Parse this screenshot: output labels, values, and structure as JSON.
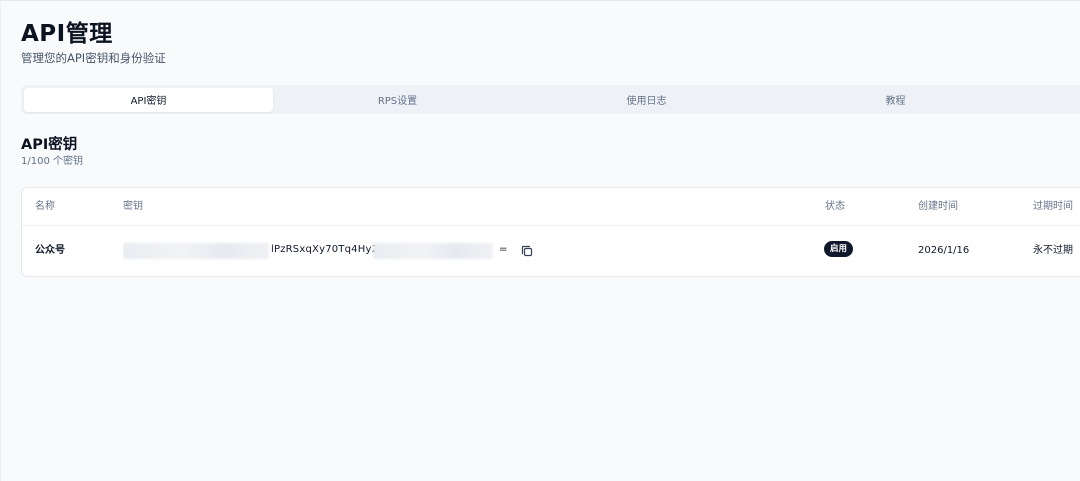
{
  "header": {
    "title": "API管理",
    "subtitle": "管理您的API密钥和身份验证"
  },
  "tabs": [
    {
      "label": "API密钥",
      "active": true
    },
    {
      "label": "RPS设置",
      "active": false
    },
    {
      "label": "使用日志",
      "active": false
    },
    {
      "label": "教程",
      "active": false
    }
  ],
  "section": {
    "title": "API密钥",
    "count": "1/100 个密钥"
  },
  "table": {
    "columns": [
      "名称",
      "密钥",
      "状态",
      "创建时间",
      "过期时间"
    ],
    "rows": [
      {
        "name": "公众号",
        "key_visible": "lPzRSxqXy70Tq4Hy2",
        "key_suffix": "=",
        "status": "启用",
        "created": "2026/1/16",
        "expires": "永不过期"
      }
    ]
  },
  "icons": {
    "copy": "copy-icon"
  },
  "colors": {
    "accent": "#0f172a",
    "muted": "#64748b",
    "background": "#f8fafc"
  }
}
